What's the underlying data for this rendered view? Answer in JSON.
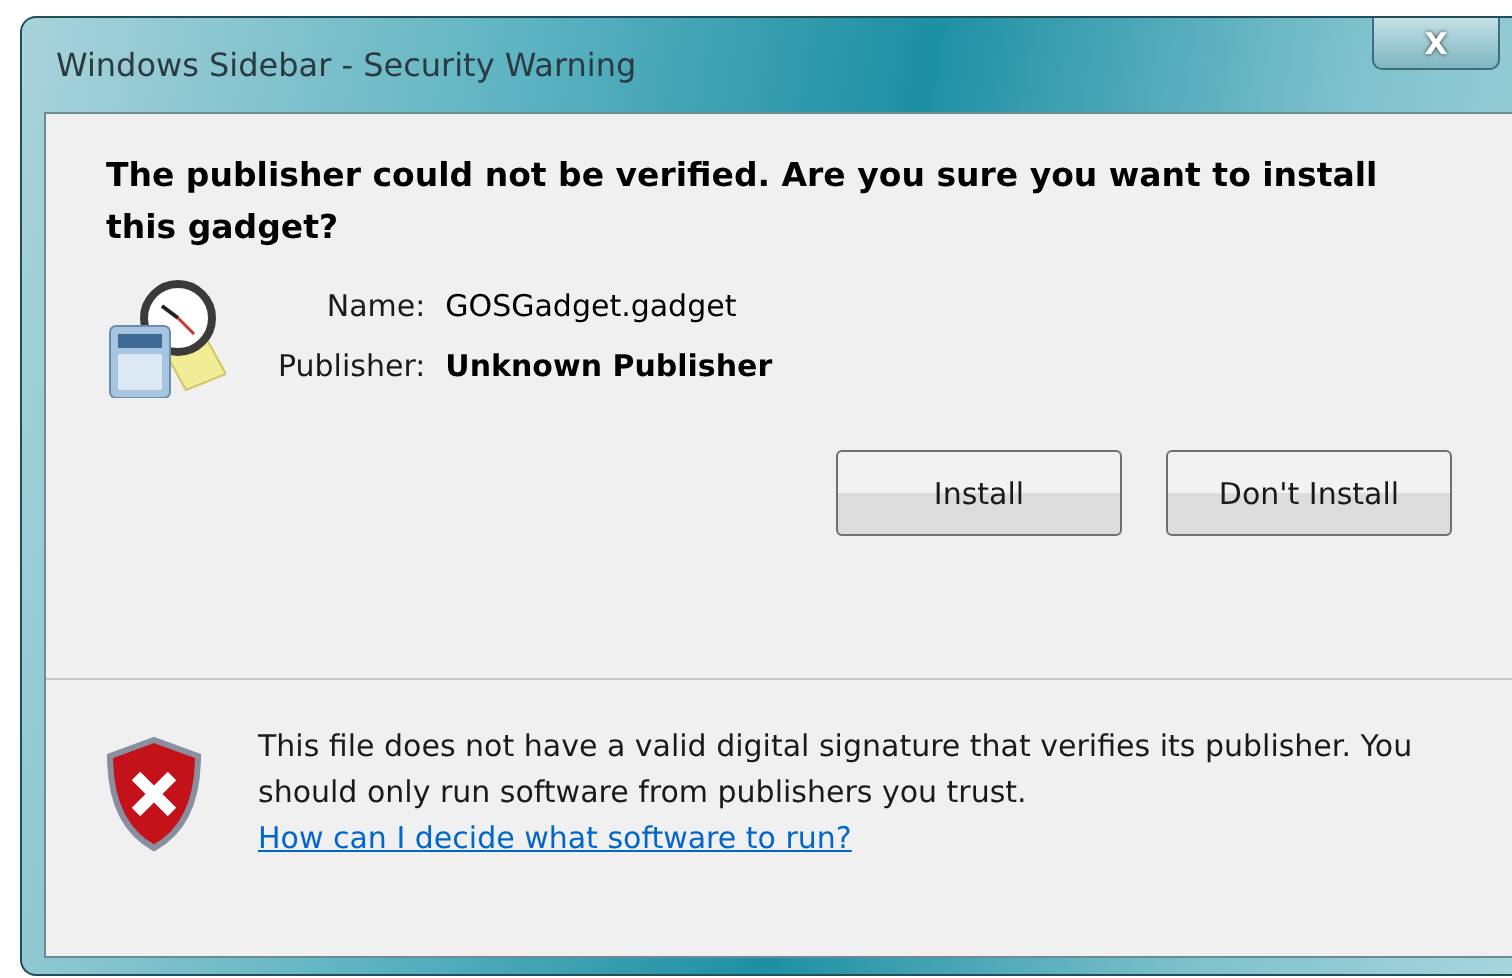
{
  "window": {
    "title": "Windows Sidebar - Security Warning",
    "close": "X"
  },
  "heading": "The publisher could not be verified. Are you sure you want to install this gadget?",
  "fields": [
    {
      "label": "Name:",
      "value": "GOSGadget.gadget",
      "bold": false
    },
    {
      "label": "Publisher:",
      "value": "Unknown Publisher",
      "bold": true
    }
  ],
  "buttons": [
    "Install",
    "Don't Install"
  ],
  "footer": {
    "text": "This file does not have a valid digital signature that verifies its publisher. You should only run software from publishers you trust.",
    "link": "How can I decide what software to run?"
  }
}
